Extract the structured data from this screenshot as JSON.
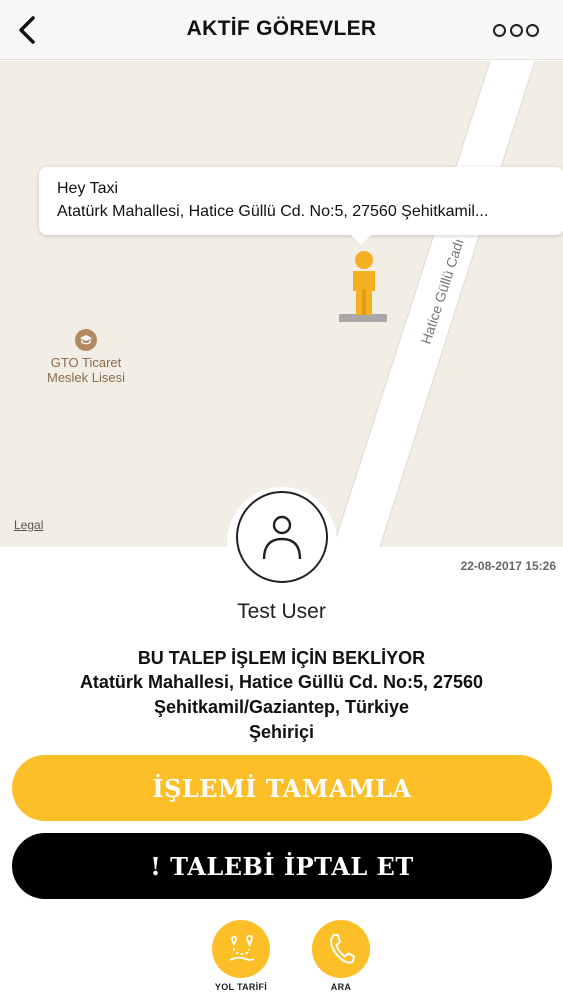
{
  "header": {
    "title": "AKTİF GÖREVLER"
  },
  "map": {
    "callout_title": "Hey Taxi",
    "callout_address": "Atatürk Mahallesi, Hatice Güllü Cd. No:5, 27560 Şehitkamil...",
    "street_label": "Hatice Güllü Cadı",
    "poi_line1": "GTO Ticaret",
    "poi_line2": "Meslek Lisesi",
    "legal_label": "Legal"
  },
  "request": {
    "timestamp": "22-08-2017 15:26",
    "user_name": "Test User",
    "status": "BU TALEP İŞLEM İÇİN BEKLİYOR",
    "address_line1": "Atatürk Mahallesi, Hatice Güllü Cd. No:5, 27560",
    "address_line2": "Şehitkamil/Gaziantep, Türkiye",
    "address_line3": "Şehiriçi"
  },
  "buttons": {
    "complete_label": "İŞLEMİ TAMAMLA",
    "cancel_label": "! TALEBİ İPTAL ET"
  },
  "actions": {
    "route_label": "YOL TARİFİ",
    "call_label": "ARA"
  },
  "colors": {
    "accent": "#fcbf27",
    "map_background": "#f2eee6",
    "cancel_button": "#000000"
  },
  "icons": {
    "back": "chevron-left-icon",
    "more": "more-circles-icon",
    "avatar": "user-icon",
    "route": "route-icon",
    "call": "phone-icon",
    "pin": "person-pin-icon",
    "poi": "school-icon"
  }
}
